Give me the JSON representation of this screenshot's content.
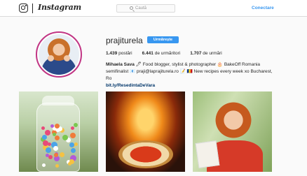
{
  "nav": {
    "wordmark": "Instagram",
    "search_placeholder": "Caută",
    "connect_label": "Conectare"
  },
  "profile": {
    "username": "prajiturela",
    "follow_label": "Urmărește",
    "stats": [
      {
        "count": "1.439",
        "label": "postări"
      },
      {
        "count": "6.441",
        "label": "de urmăritori"
      },
      {
        "count": "1.707",
        "label": "de urmări"
      }
    ],
    "bio_name": "Mihaela Sava",
    "bio_line1_rest": "🖊 Food blogger, stylist & photographer 🎂 BakeOff Romania",
    "bio_line2": "semifinalist 📧 praji@laprajiturela.ro 📝 🇷🇴 New recipes every week xo Bucharest, Ro",
    "bio_link": "bit.ly/ResedintaDeVara"
  },
  "grid": {
    "posts": [
      {
        "subject": "candy jar"
      },
      {
        "subject": "pizza in oven"
      },
      {
        "subject": "woman with book"
      }
    ]
  },
  "colors": {
    "accent": "#3897f0",
    "ring": "#c13584",
    "text": "#262626"
  }
}
